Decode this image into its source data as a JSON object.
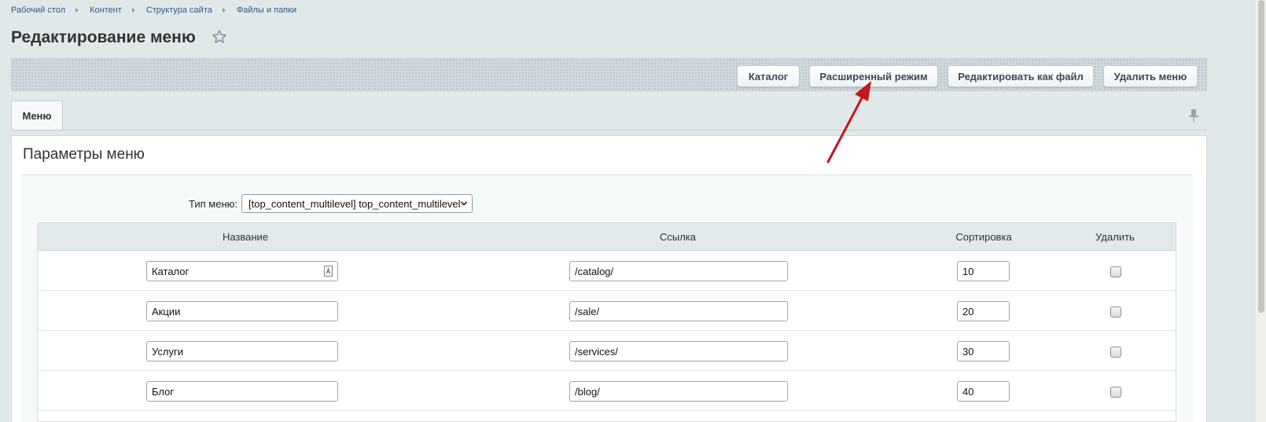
{
  "breadcrumb": [
    "Рабочий стол",
    "Контент",
    "Структура сайта",
    "Файлы и папки"
  ],
  "page": {
    "title": "Редактирование меню"
  },
  "toolbar": {
    "catalog": "Каталог",
    "advanced_mode": "Расширенный режим",
    "edit_as_file": "Редактировать как файл",
    "delete_menu": "Удалить меню"
  },
  "tabs": [
    {
      "label": "Меню",
      "active": true
    }
  ],
  "section": {
    "title": "Параметры меню"
  },
  "menu_type": {
    "label": "Тип меню:",
    "value": "[top_content_multilevel] top_content_multilevel"
  },
  "table": {
    "headers": {
      "name": "Название",
      "link": "Ссылка",
      "sort": "Сортировка",
      "delete": "Удалить"
    },
    "rows": [
      {
        "name": "Каталог",
        "link": "/catalog/",
        "sort": "10",
        "delete": false
      },
      {
        "name": "Акции",
        "link": "/sale/",
        "sort": "20",
        "delete": false
      },
      {
        "name": "Услуги",
        "link": "/services/",
        "sort": "30",
        "delete": false
      },
      {
        "name": "Блог",
        "link": "/blog/",
        "sort": "40",
        "delete": false
      }
    ]
  },
  "colors": {
    "accent": "#2d5b8a",
    "arrow": "#c4161c",
    "background": "#e0e8ea"
  },
  "icons": {
    "favorite": "star-icon",
    "pin": "pin-icon",
    "select": "chevron-down-icon",
    "lang": "lang-icon"
  }
}
